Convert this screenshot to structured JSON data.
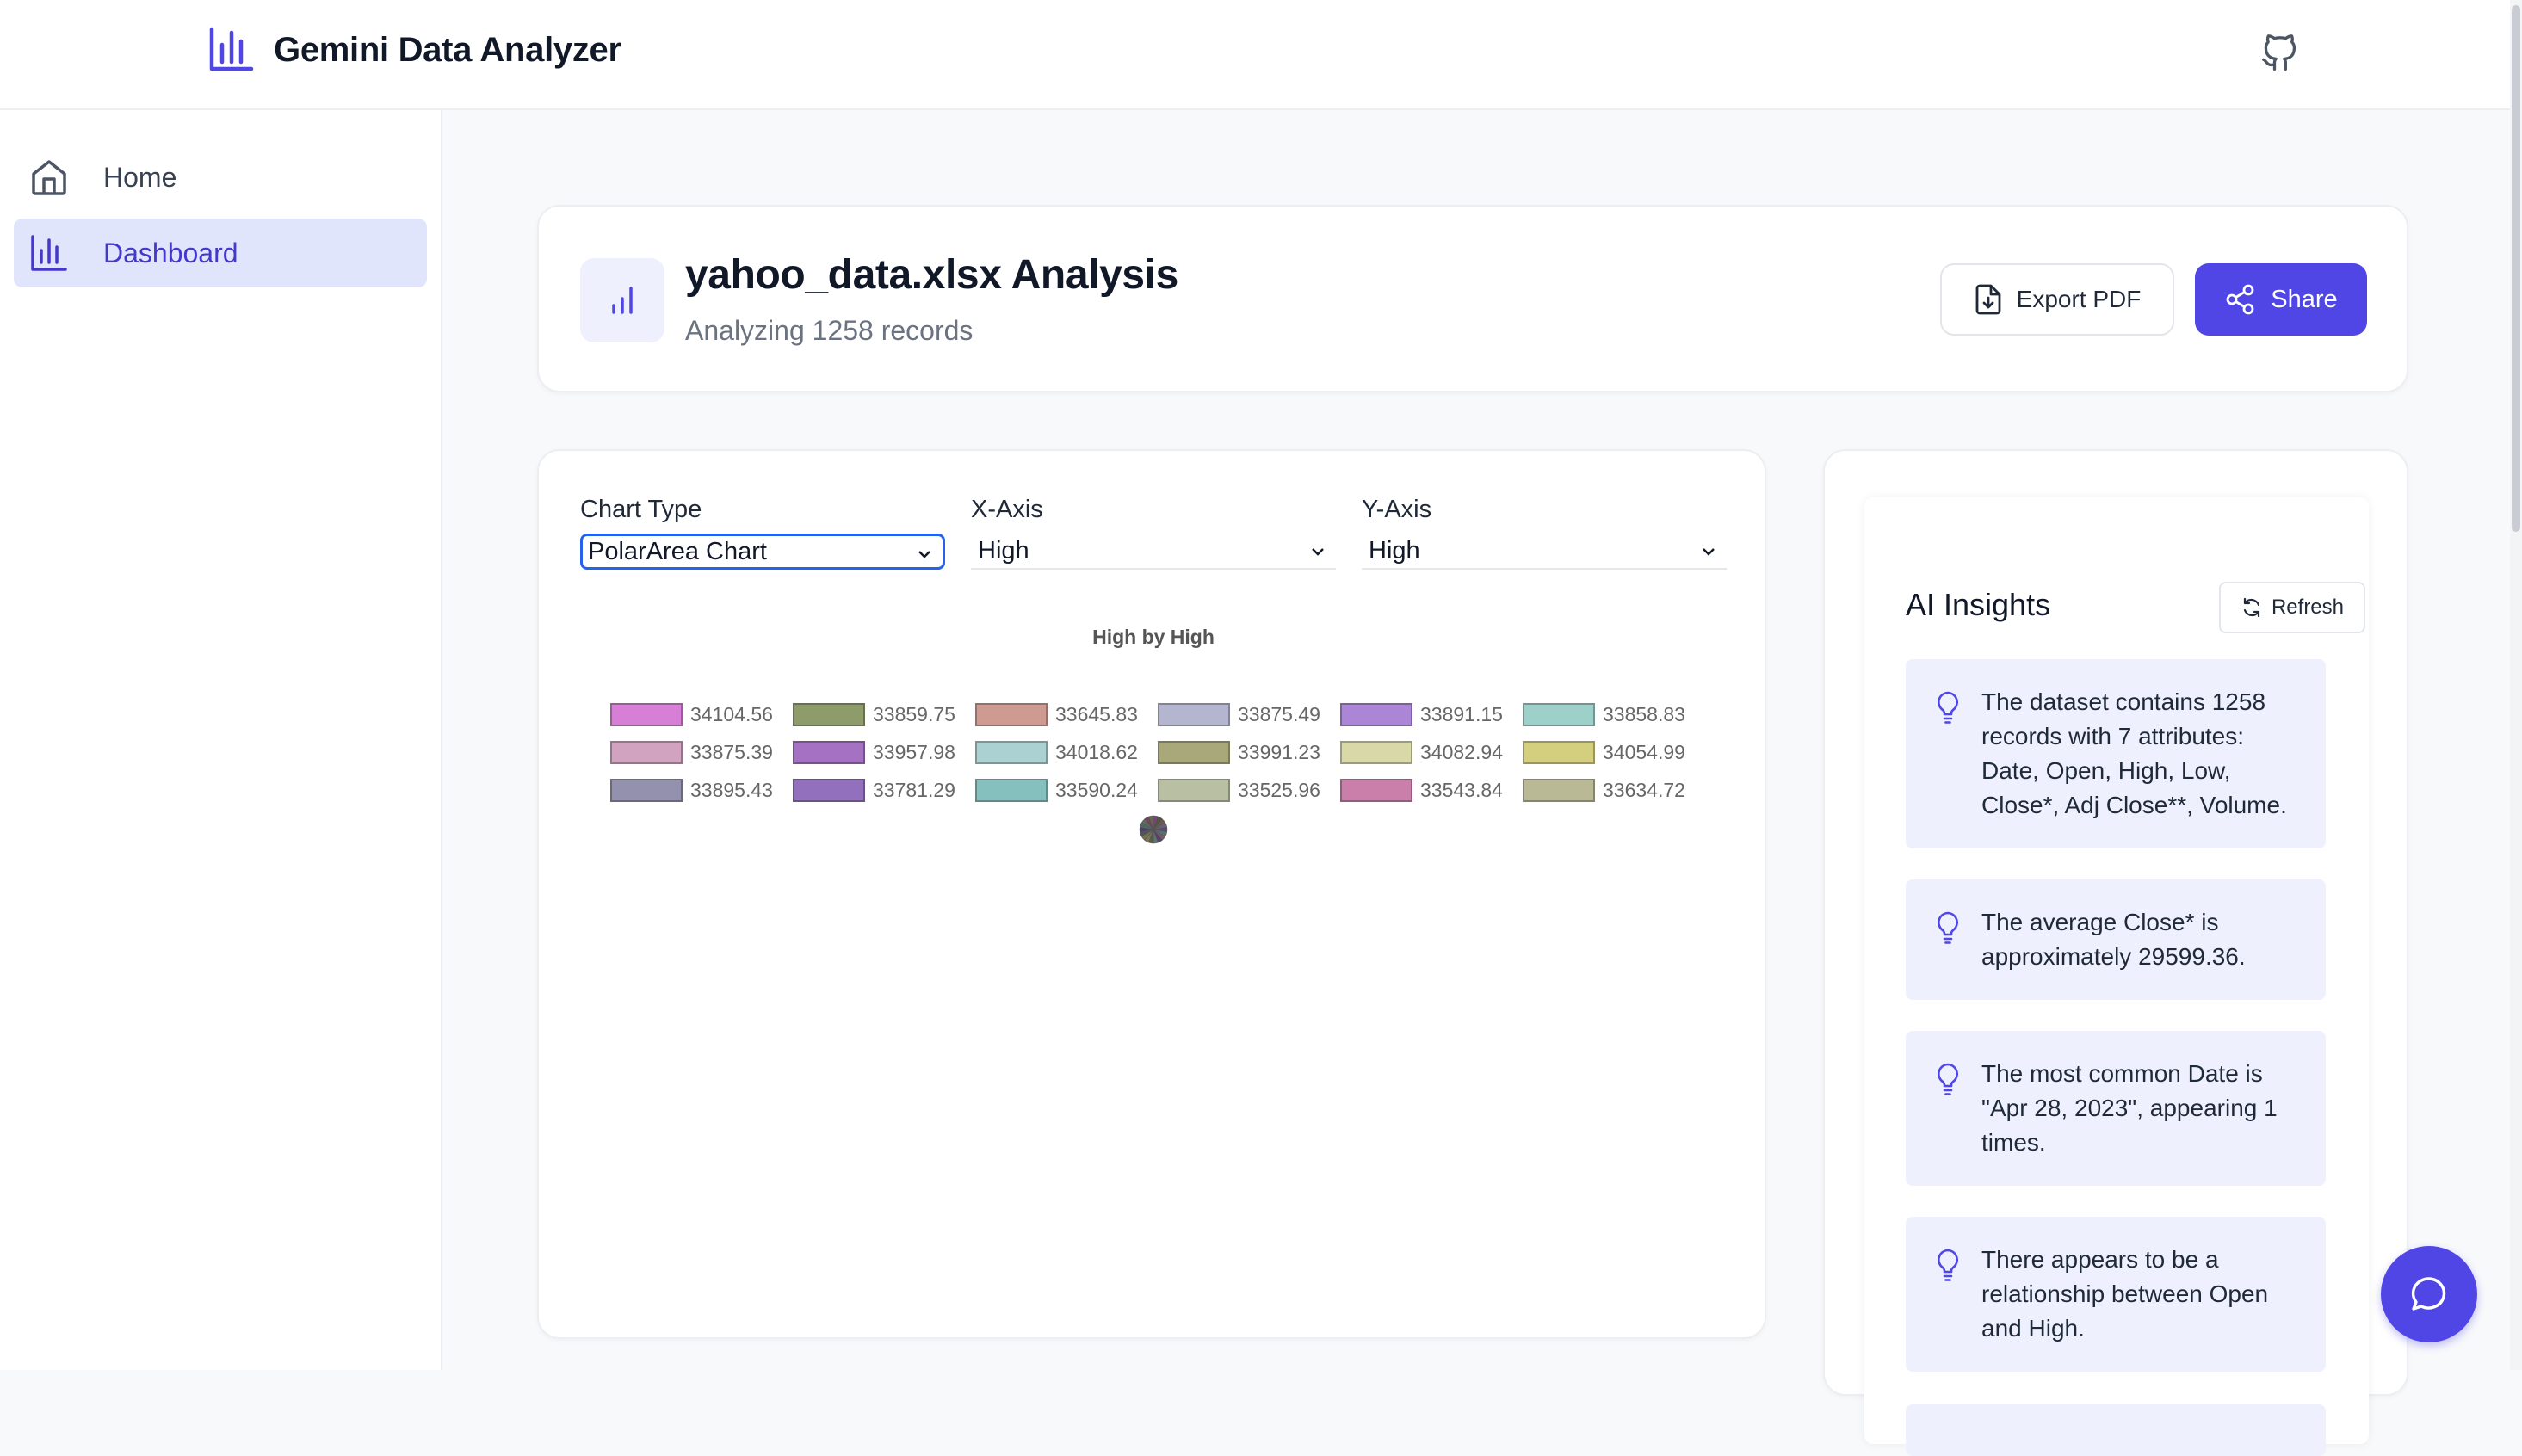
{
  "app": {
    "title": "Gemini Data Analyzer"
  },
  "sidebar": {
    "items": [
      {
        "label": "Home",
        "icon": "home-icon"
      },
      {
        "label": "Dashboard",
        "icon": "bar-chart-icon",
        "active": true
      }
    ]
  },
  "header_card": {
    "title": "yahoo_data.xlsx Analysis",
    "subtitle": "Analyzing 1258 records",
    "export_label": "Export PDF",
    "share_label": "Share"
  },
  "controls": {
    "chart_type_label": "Chart Type",
    "chart_type_value": "PolarArea Chart",
    "x_axis_label": "X-Axis",
    "x_axis_value": "High",
    "y_axis_label": "Y-Axis",
    "y_axis_value": "High"
  },
  "chart_data": {
    "type": "polarArea",
    "title": "High by High",
    "legend_position": "top",
    "labels": [
      "34104.56",
      "33859.75",
      "33645.83",
      "33875.49",
      "33891.15",
      "33858.83",
      "33875.39",
      "33957.98",
      "34018.62",
      "33991.23",
      "34082.94",
      "34054.99",
      "33895.43",
      "33781.29",
      "33590.24",
      "33525.96",
      "33543.84",
      "33634.72"
    ],
    "values": [
      34104.56,
      33859.75,
      33645.83,
      33875.49,
      33891.15,
      33858.83,
      33875.39,
      33957.98,
      34018.62,
      33991.23,
      34082.94,
      34054.99,
      33895.43,
      33781.29,
      33590.24,
      33525.96,
      33543.84,
      33634.72
    ],
    "colors": [
      "#d77fd6",
      "#8e9c6c",
      "#cf9a91",
      "#b4b5cf",
      "#ab85d8",
      "#9dd0c9",
      "#d1a3c0",
      "#a471c3",
      "#abd1d2",
      "#a9a87a",
      "#d8d8a9",
      "#d4cf7f",
      "#9391ad",
      "#9370bd",
      "#86c0be",
      "#b8bfa3",
      "#c97fa9",
      "#bab996"
    ]
  },
  "insights": {
    "title": "AI Insights",
    "refresh_label": "Refresh",
    "items": [
      "The dataset contains 1258 records with 7 attributes: Date, Open, High, Low, Close*, Adj Close**, Volume.",
      "The average Close* is approximately 29599.36.",
      "The most common Date is \"Apr 28, 2023\", appearing 1 times.",
      "There appears to be a relationship between Open and High."
    ]
  },
  "colors": {
    "accent": "#4f46e5",
    "active_nav_bg": "#e0e5fb",
    "insight_bg": "#eef0fd"
  }
}
